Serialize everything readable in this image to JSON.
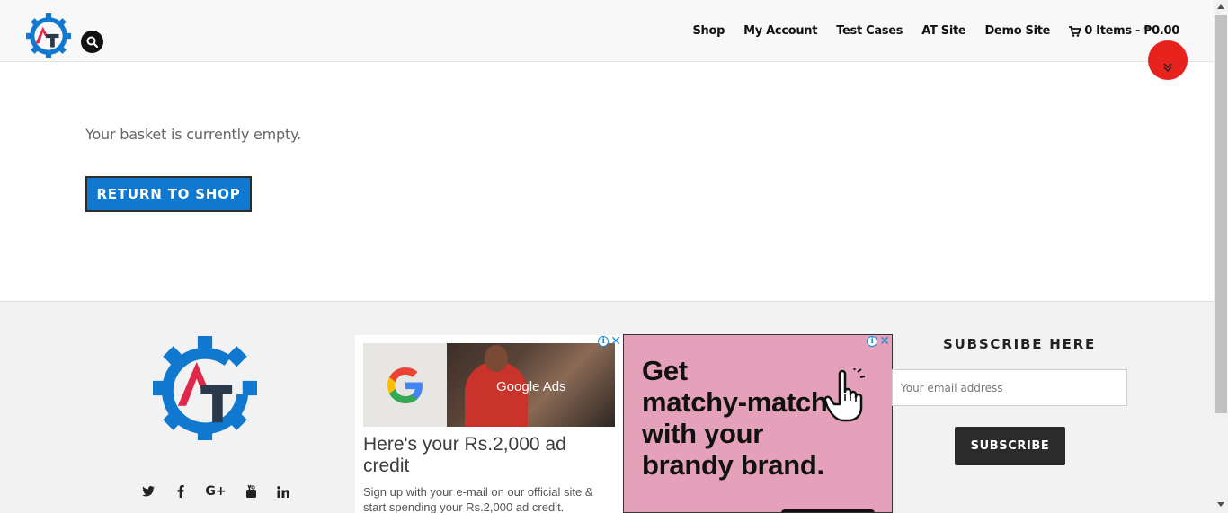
{
  "header": {
    "logo_icon": "at-gear-logo-icon",
    "search_icon": "search-icon",
    "nav": [
      "Shop",
      "My Account",
      "Test Cases",
      "AT Site",
      "Demo Site"
    ],
    "cart_icon": "cart-icon",
    "cart_label": "0 Items - ₱0.00"
  },
  "main": {
    "empty_message": "Your basket is currently empty.",
    "return_button": "RETURN TO SHOP"
  },
  "footer": {
    "social_icons": [
      "twitter-icon",
      "facebook-icon",
      "google-plus-icon",
      "youtube-icon",
      "linkedin-icon"
    ],
    "ad1": {
      "image_label": "Google Ads",
      "title": "Here's your Rs.2,000 ad credit",
      "subtitle": "Sign up with your e-mail on our official site & start spending your Rs.2,000 ad credit."
    },
    "ad2": {
      "lines": [
        "Get",
        "matchy-match",
        "with your",
        "brandy brand."
      ]
    },
    "subscribe": {
      "title": "SUBSCRIBE HERE",
      "email_placeholder": "Your email address",
      "button": "SUBSCRIBE"
    }
  },
  "colors": {
    "accent_blue": "#1079cf",
    "scroll_red": "#e8231d",
    "logo_red": "#e0284a",
    "logo_dark": "#2b3a4a",
    "ad_pink": "#e5a0ba"
  }
}
